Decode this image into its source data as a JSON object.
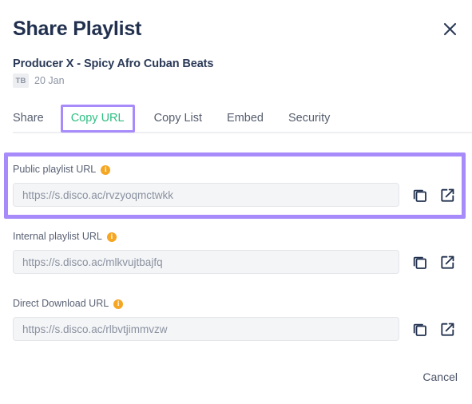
{
  "dialog": {
    "title": "Share Playlist",
    "close_icon": "close-icon",
    "subtitle": "Producer X - Spicy Afro Cuban Beats",
    "avatar_initials": "TB",
    "date": "20 Jan"
  },
  "tabs": [
    {
      "label": "Share",
      "active": false,
      "highlighted": false
    },
    {
      "label": "Copy URL",
      "active": true,
      "highlighted": true
    },
    {
      "label": "Copy List",
      "active": false,
      "highlighted": false
    },
    {
      "label": "Embed",
      "active": false,
      "highlighted": false
    },
    {
      "label": "Security",
      "active": false,
      "highlighted": false
    }
  ],
  "fields": [
    {
      "label": "Public playlist URL",
      "info_icon": "info-icon",
      "value": "https://s.disco.ac/rvzyoqmctwkk",
      "copy_icon": "copy-icon",
      "open_icon": "external-link-icon",
      "highlighted": true
    },
    {
      "label": "Internal playlist URL",
      "info_icon": "info-icon",
      "value": "https://s.disco.ac/mlkvujtbajfq",
      "copy_icon": "copy-icon",
      "open_icon": "external-link-icon",
      "highlighted": false
    },
    {
      "label": "Direct Download URL",
      "info_icon": "info-icon",
      "value": "https://s.disco.ac/rlbvtjimmvzw",
      "copy_icon": "copy-icon",
      "open_icon": "external-link-icon",
      "highlighted": false
    }
  ],
  "footer": {
    "cancel_label": "Cancel"
  },
  "info_icon_char": "i",
  "colors": {
    "title": "#21304e",
    "active_tab": "#2dbf82",
    "highlight_purple": "#a78bfa",
    "info_orange": "#f5a623",
    "input_bg": "#f4f5f7",
    "muted_text": "#8a919f"
  }
}
